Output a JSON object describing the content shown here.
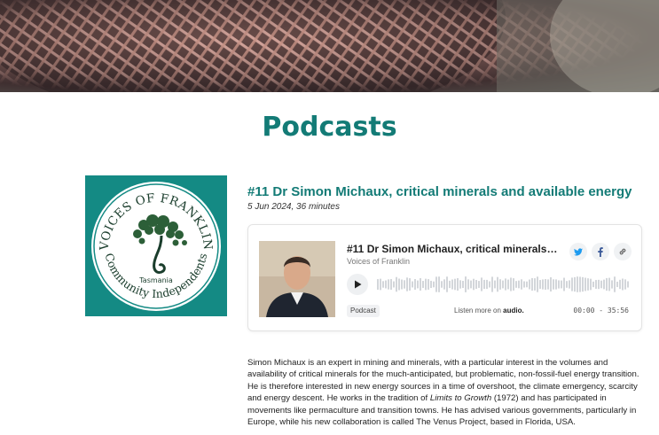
{
  "page": {
    "title": "Podcasts"
  },
  "logo": {
    "arc_text": "VOICES OF FRANKLIN",
    "region": "Tasmania",
    "bottom_text": "Community Independents",
    "background": "#148a84"
  },
  "episode": {
    "title": "#11 Dr Simon Michaux, critical minerals and available energy",
    "meta": "5 Jun 2024, 36 minutes"
  },
  "player": {
    "title": "#11 Dr Simon Michaux, critical minerals an...",
    "show": "Voices of Franklin",
    "tag": "Podcast",
    "listen_prefix": "Listen more on",
    "listen_brand": "audio.",
    "time": "00:00 - 35:56",
    "icons": [
      "twitter-icon",
      "facebook-icon",
      "link-icon",
      "play-icon"
    ]
  },
  "description": {
    "part1": "Simon Michaux is an expert in mining and minerals, with a particular interest in the volumes and availability of critical minerals for the much-anticipated, but problematic, non-fossil-fuel energy transition. He is therefore interested in new energy sources in a time of overshoot, the climate emergency, scarcity and energy descent. He works in the tradition of ",
    "book": "Limits to Growth",
    "part2": " (1972) and has participated in movements like permaculture and transition towns. He has advised various governments, particularly in Europe, while his new collaboration is called The Venus Project, based in Florida, USA."
  },
  "colors": {
    "accent": "#137b76",
    "logo_bg": "#148a84"
  }
}
